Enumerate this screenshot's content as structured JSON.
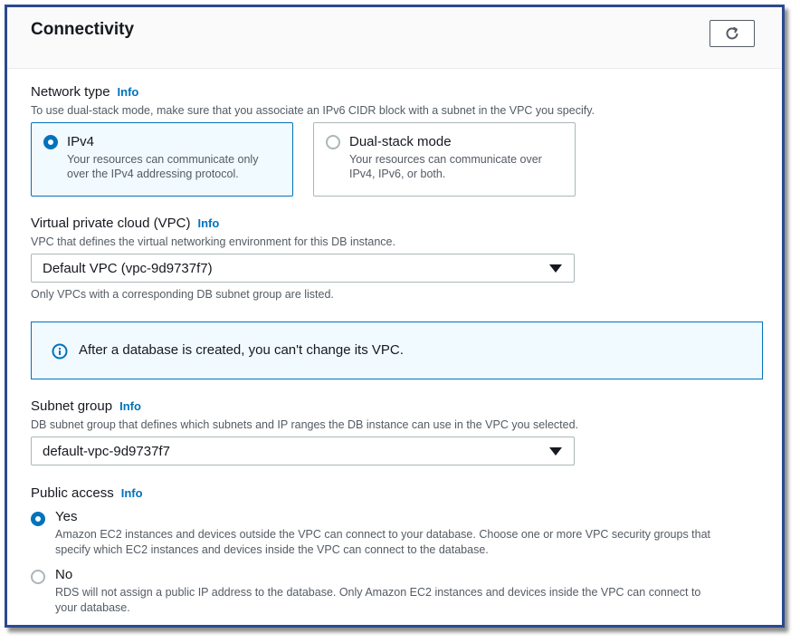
{
  "header": {
    "title": "Connectivity",
    "refresh_icon": "refresh-icon"
  },
  "network_type": {
    "label": "Network type",
    "info": "Info",
    "description": "To use dual-stack mode, make sure that you associate an IPv6 CIDR block with a subnet in the VPC you specify.",
    "options": [
      {
        "title": "IPv4",
        "desc_line1": "Your resources can communicate only",
        "desc_line2": "over the IPv4 addressing protocol.",
        "selected": true
      },
      {
        "title": "Dual-stack mode",
        "desc_line1": "Your resources can communicate over",
        "desc_line2": "IPv4, IPv6, or both.",
        "selected": false
      }
    ]
  },
  "vpc": {
    "label": "Virtual private cloud (VPC)",
    "info": "Info",
    "description": "VPC that defines the virtual networking environment for this DB instance.",
    "value": "Default VPC (vpc-9d9737f7)",
    "hint": "Only VPCs with a corresponding DB subnet group are listed."
  },
  "alert": {
    "icon": "info-circle-icon",
    "text": "After a database is created, you can't change its VPC."
  },
  "subnet_group": {
    "label": "Subnet group",
    "info": "Info",
    "description": "DB subnet group that defines which subnets and IP ranges the DB instance can use in the VPC you selected.",
    "value": "default-vpc-9d9737f7"
  },
  "public_access": {
    "label": "Public access",
    "info": "Info",
    "options": [
      {
        "title": "Yes",
        "desc_line1": "Amazon EC2 instances and devices outside the VPC can connect to your database. Choose one or more VPC security groups that",
        "desc_line2": "specify which EC2 instances and devices inside the VPC can connect to the database.",
        "selected": true
      },
      {
        "title": "No",
        "desc_line1": "RDS will not assign a public IP address to the database. Only Amazon EC2 instances and devices inside the VPC can connect to",
        "desc_line2": "your database.",
        "selected": false
      }
    ]
  },
  "colors": {
    "accent": "#0073bb",
    "frame": "#2b4a8f",
    "text": "#16191f",
    "muted": "#545b64"
  }
}
